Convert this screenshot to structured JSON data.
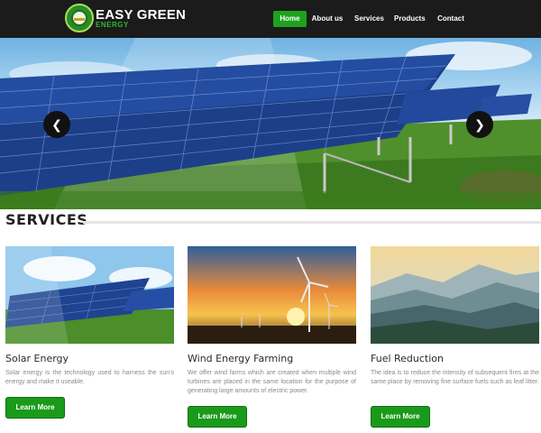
{
  "brand": {
    "line1": "EASY GREEN",
    "line2": "ENERGY"
  },
  "nav": [
    {
      "label": "Home",
      "active": true
    },
    {
      "label": "About us",
      "active": false
    },
    {
      "label": "Services",
      "active": false
    },
    {
      "label": "Products",
      "active": false
    },
    {
      "label": "Contact",
      "active": false
    }
  ],
  "hero": {
    "prev_icon": "arrow-left-icon",
    "next_icon": "arrow-right-icon"
  },
  "services": {
    "heading": "SERVICES",
    "cards": [
      {
        "title": "Solar Energy",
        "text": "Solar energy is the technology used to harness the sun's energy and make it useable.",
        "button": "Learn More"
      },
      {
        "title": "Wind Energy Farming",
        "text": "We offer wind farms which are created when multiple wind turbines are placed in the same location for the purpose of generating large amounts of electric power.",
        "button": "Learn More"
      },
      {
        "title": "Fuel Reduction",
        "text": "The idea is to reduce the intensity of subsequent fires at the same place by removing fine surface fuels such as leaf litter.",
        "button": "Learn More"
      }
    ]
  },
  "colors": {
    "accent": "#1ea21e",
    "nav_bg": "#1b1b1b",
    "brand_green": "#33b233"
  }
}
